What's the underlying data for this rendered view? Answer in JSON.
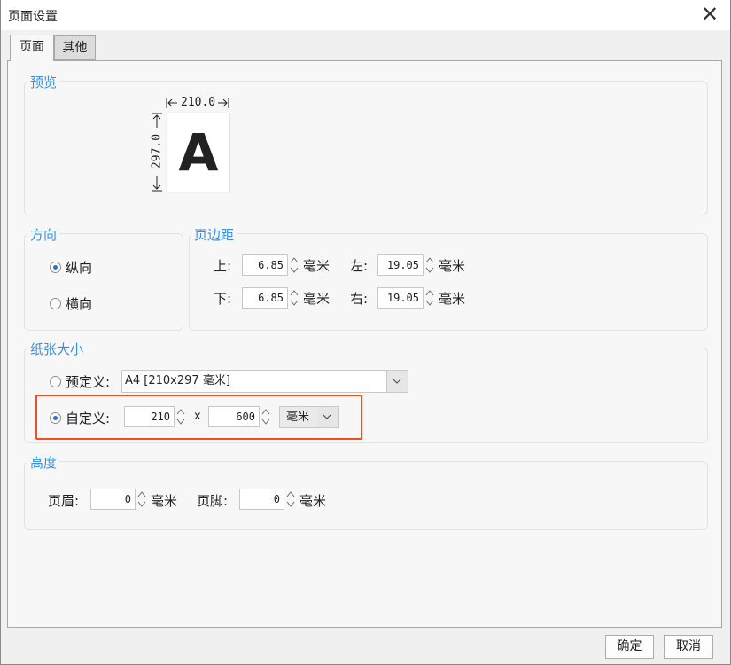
{
  "window": {
    "title": "页面设置",
    "close_label": "✕"
  },
  "tabs": [
    {
      "label": "页面",
      "active": true
    },
    {
      "label": "其他",
      "active": false
    }
  ],
  "preview": {
    "group_label": "预览",
    "width_label": "210.0",
    "height_label": "297.0",
    "letter": "A"
  },
  "orientation": {
    "group_label": "方向",
    "portrait_label": "纵向",
    "landscape_label": "横向",
    "selected": "portrait"
  },
  "margins": {
    "group_label": "页边距",
    "top_label": "上:",
    "top_value": "6.85",
    "left_label": "左:",
    "left_value": "19.05",
    "bottom_label": "下:",
    "bottom_value": "6.85",
    "right_label": "右:",
    "right_value": "19.05",
    "unit": "毫米"
  },
  "paper_size": {
    "group_label": "纸张大小",
    "predefined_label": "预定义:",
    "predefined_value": "A4 [210x297 毫米]",
    "custom_label": "自定义:",
    "custom_width": "210",
    "times": "x",
    "custom_height": "600",
    "unit_value": "毫米",
    "selected": "custom"
  },
  "height": {
    "group_label": "高度",
    "header_label": "页眉:",
    "header_value": "0",
    "footer_label": "页脚:",
    "footer_value": "0",
    "unit": "毫米"
  },
  "buttons": {
    "ok": "确定",
    "cancel": "取消"
  },
  "colors": {
    "accent": "#3a8fe0",
    "highlight": "#f0501f",
    "radio_dot": "#2a72d0"
  }
}
